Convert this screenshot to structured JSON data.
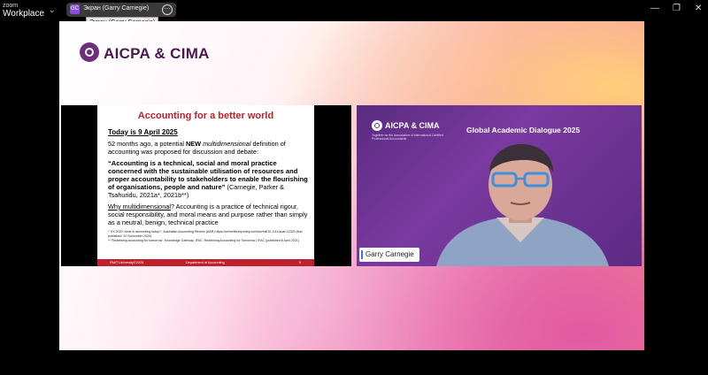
{
  "app": {
    "brand_small": "zoom",
    "brand_large": "Workplace"
  },
  "share": {
    "avatar_initials": "GC",
    "label": "Экран (Garry Carnegie)",
    "tooltip": "Экран (Garry Carnegie)",
    "more_glyph": "⋯"
  },
  "window_controls": {
    "minimize": "—",
    "maximize": "❐",
    "close": "✕"
  },
  "stage": {
    "brand_logo": "AICPA & CIMA"
  },
  "slide": {
    "title": "Accounting for a better world",
    "date": "Today is 9 April 2025",
    "para1_pre": "52 months ago, a potential ",
    "para1_new": "NEW",
    "para1_multi": "multidimensional",
    "para1_post": " definition of accounting was proposed for discussion and debate:",
    "quote": "“Accounting is a technical, social and moral practice concerned with the sustainable utilisation of resources and proper accountability to stakeholders to enable the flourishing of organisations, people and nature”",
    "citation": "(Carnegie, Parker & Tsahuridu, 2021a*, 2021b**)",
    "why_label": "Why multidimensional",
    "why_rest": "? Accounting is a practice of technical rigour, social responsibility, and moral means and purpose rather than simply as a neutral, benign, technical practice",
    "footnote1": "* 'It's 2020: what is accounting today?', Australian Accounting Review (AAR) https://onlinelibrary.wiley.com/doi/full/10.1111/auar.12325 (first published: 22 November 2020)",
    "footnote2": "** 'Redefining accounting for tomorrow', Knowledge Gateway, IFAC: Redefining Accounting for Tomorrow | IFAC (published 6 April 2021)",
    "footer_left": "RMIT University©2025",
    "footer_mid": "Department of Accounting",
    "footer_page": "5"
  },
  "video": {
    "logo": "AICPA & CIMA",
    "logo_sub": "Together as the Association of International Certified Professional Accountants",
    "event_title": "Global Academic Dialogue 2025",
    "participant_name": "Garry Carnegie"
  },
  "colors": {
    "slide_accent": "#c0202a",
    "brand_purple": "#6d2e7a",
    "video_bg": "#5a2b80",
    "name_tag_accent": "#2f7cf6"
  }
}
